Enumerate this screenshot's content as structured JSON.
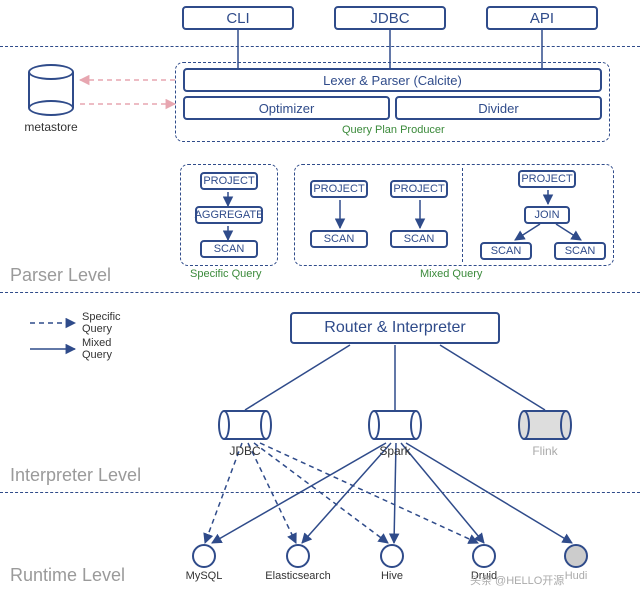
{
  "top_interfaces": {
    "cli": "CLI",
    "jdbc": "JDBC",
    "api": "API"
  },
  "producer": {
    "lexer": "Lexer & Parser (Calcite)",
    "optimizer": "Optimizer",
    "divider": "Divider",
    "group_label": "Query Plan Producer"
  },
  "metastore": {
    "label": "metastore"
  },
  "queries": {
    "specific": {
      "label": "Specific Query",
      "nodes": {
        "project": "PROJECT",
        "aggregate": "AGGREGATE",
        "scan": "SCAN"
      }
    },
    "mixed": {
      "label": "Mixed Query",
      "plan_a": {
        "project": "PROJECT",
        "scan": "SCAN"
      },
      "plan_b": {
        "project": "PROJECT",
        "scan": "SCAN"
      },
      "plan_c": {
        "project": "PROJECT",
        "join": "JOIN",
        "scan_l": "SCAN",
        "scan_r": "SCAN"
      }
    }
  },
  "legend": {
    "specific": "Specific Query",
    "mixed": "Mixed Query"
  },
  "router": {
    "label": "Router & Interpreter"
  },
  "engines": {
    "jdbc": "JDBC",
    "spark": "Spark",
    "flink": "Flink"
  },
  "runtimes": {
    "mysql": "MySQL",
    "elasticsearch": "Elasticsearch",
    "hive": "Hive",
    "druid": "Druid",
    "hudi": "Hudi"
  },
  "levels": {
    "parser": "Parser Level",
    "interpreter": "Interpreter Level",
    "runtime": "Runtime Level"
  },
  "watermark": "头条 @HELLO开源"
}
